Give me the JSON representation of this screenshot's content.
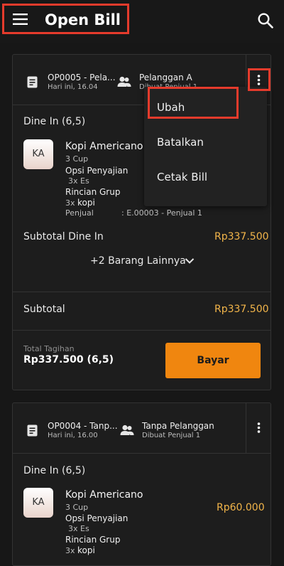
{
  "header": {
    "title": "Open Bill"
  },
  "bill1": {
    "order": "OP0005 - Pela...",
    "date": "Hari ini, 16.04",
    "customer": "Pelanggan A",
    "creator": "Dibuat Penjual 1",
    "section": "Dine In (6,5)",
    "item": {
      "badge": "KA",
      "name": "Kopi Americano",
      "qty": "3 Cup",
      "opsi_label": "Opsi Penyajian",
      "opsi_value": "3x Es",
      "grup_label": "Rincian Grup",
      "grup_qty": "3x",
      "grup_name": "kopi",
      "seller_label": "Penjual",
      "seller_value": ": E.00003 - Penjual 1"
    },
    "subtotal_dinein_label": "Subtotal Dine In",
    "subtotal_dinein_value": "Rp337.500",
    "more": "+2 Barang Lainnya",
    "subtotal_label": "Subtotal",
    "subtotal_value": "Rp337.500",
    "total_label": "Total Tagihan",
    "total_value": "Rp337.500 (6,5)",
    "pay_button": "Bayar"
  },
  "menu": {
    "items": [
      "Ubah",
      "Batalkan",
      "Cetak Bill"
    ]
  },
  "bill2": {
    "order": "OP0004 - Tanp...",
    "date": "Hari ini, 16.00",
    "customer": "Tanpa Pelanggan",
    "creator": "Dibuat Penjual 1",
    "section": "Dine In (6,5)",
    "item": {
      "badge": "KA",
      "name": "Kopi Americano",
      "qty": "3 Cup",
      "price": "Rp60.000",
      "opsi_label": "Opsi Penyajian",
      "opsi_value": "3x Es",
      "grup_label": "Rincian Grup",
      "grup_qty": "3x",
      "grup_name": "kopi"
    }
  },
  "colors": {
    "accent": "#f0860f",
    "price": "#f2b54a",
    "highlight": "#e53b2c"
  }
}
